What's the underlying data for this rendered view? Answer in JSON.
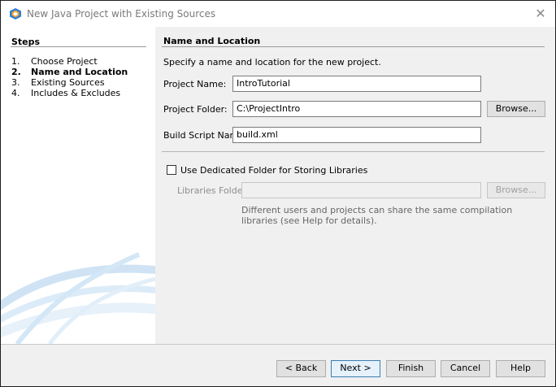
{
  "window": {
    "title": "New Java Project with Existing Sources"
  },
  "steps": {
    "title": "Steps",
    "items": [
      {
        "num": "1.",
        "label": "Choose Project"
      },
      {
        "num": "2.",
        "label": "Name and Location"
      },
      {
        "num": "3.",
        "label": "Existing Sources"
      },
      {
        "num": "4.",
        "label": "Includes & Excludes"
      }
    ],
    "current_index": 1
  },
  "panel": {
    "title": "Name and Location",
    "description": "Specify a name and location for the new project.",
    "project_name_label": "Project Name:",
    "project_name_value": "IntroTutorial",
    "project_folder_label": "Project Folder:",
    "project_folder_value": "C:\\ProjectIntro",
    "browse_label": "Browse...",
    "build_script_label": "Build Script Name:",
    "build_script_value": "build.xml",
    "dedicated_folder_label": "Use Dedicated Folder for Storing Libraries",
    "dedicated_folder_checked": false,
    "libraries_folder_label": "Libraries Folder:",
    "libraries_folder_value": "",
    "libraries_browse_label": "Browse...",
    "hint_line1": "Different users and projects can share the same compilation",
    "hint_line2": "libraries (see Help for details)."
  },
  "buttons": {
    "back": "< Back",
    "next": "Next >",
    "finish": "Finish",
    "cancel": "Cancel",
    "help": "Help"
  },
  "icons": {
    "app": "netbeans-cube-icon",
    "close": "close-icon"
  },
  "colors": {
    "accent": "#3c7fb1",
    "app_icon_blue": "#2f7fd0",
    "app_icon_orange": "#f0a030"
  }
}
